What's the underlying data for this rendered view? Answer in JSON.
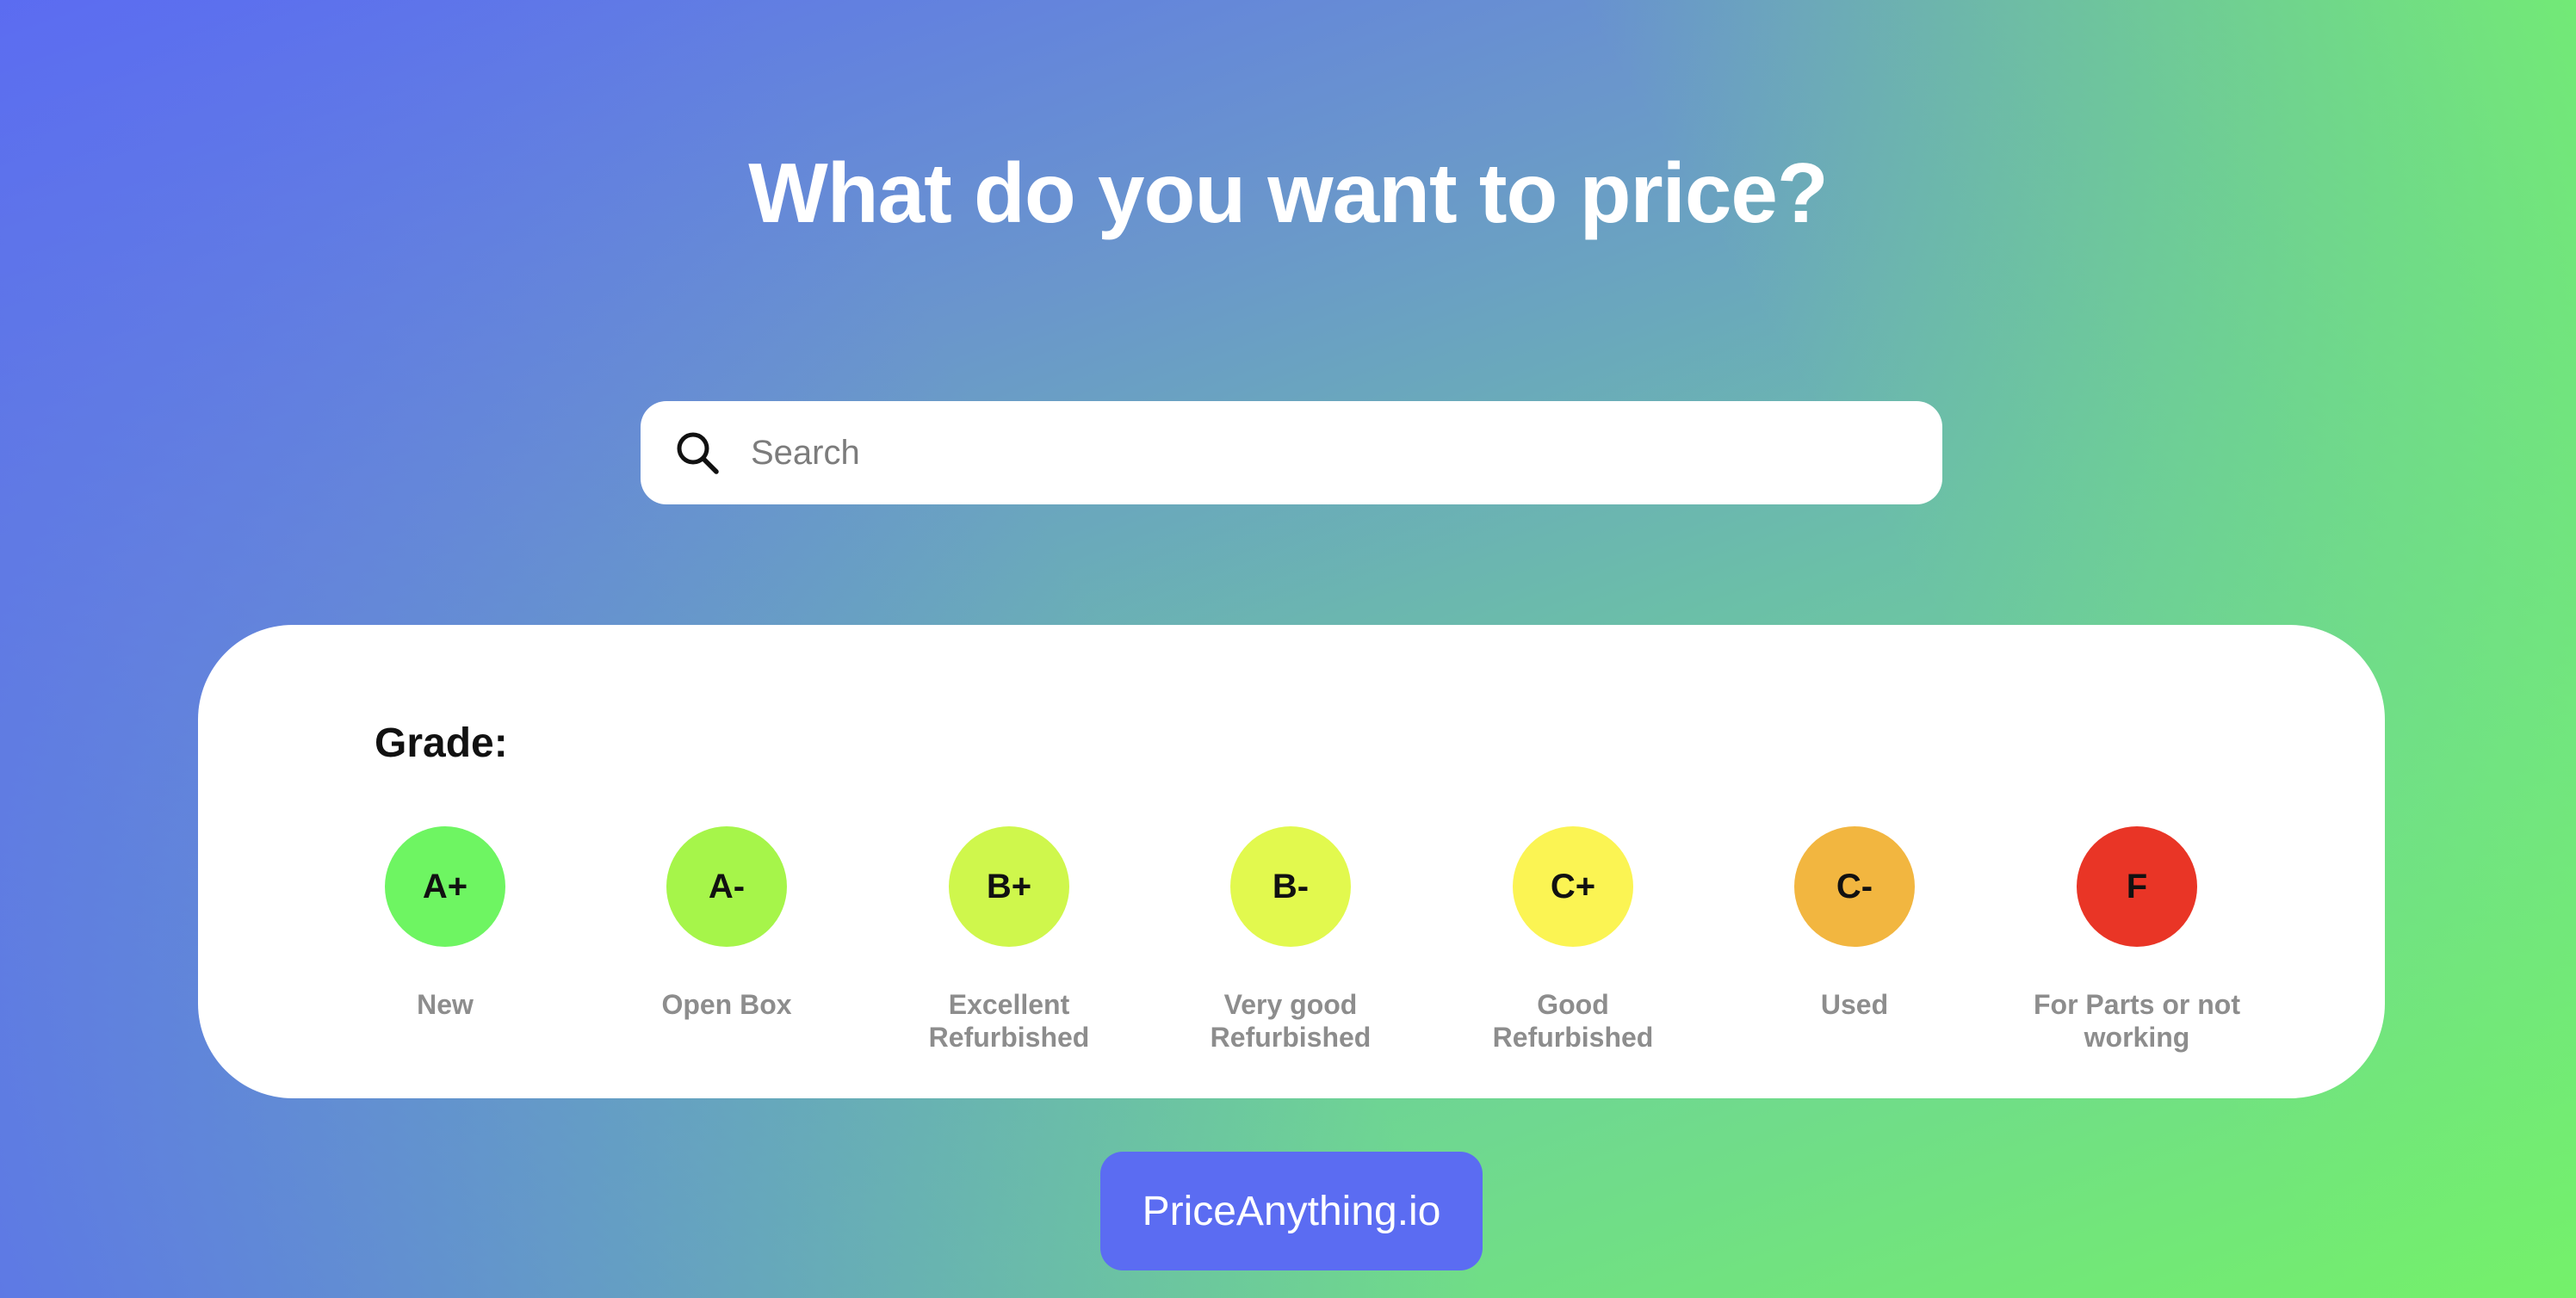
{
  "header": {
    "title": "What do you want to price?"
  },
  "search": {
    "placeholder": "Search",
    "value": "",
    "icon": "search-icon"
  },
  "grade_panel": {
    "label": "Grade:",
    "grades": [
      {
        "grade": "A+",
        "description": "New",
        "color": "#6ef562"
      },
      {
        "grade": "A-",
        "description": "Open Box",
        "color": "#a6f54a"
      },
      {
        "grade": "B+",
        "description": "Excellent Refurbished",
        "color": "#cff74c"
      },
      {
        "grade": "B-",
        "description": "Very good Refurbished",
        "color": "#e2f94e"
      },
      {
        "grade": "C+",
        "description": "Good Refurbished",
        "color": "#fbf453"
      },
      {
        "grade": "C-",
        "description": "Used",
        "color": "#f2b640"
      },
      {
        "grade": "F",
        "description": "For Parts or not working",
        "color": "#e93526"
      }
    ]
  },
  "footer": {
    "brand_label": "PriceAnything.io",
    "brand_color": "#5b6cf2"
  }
}
